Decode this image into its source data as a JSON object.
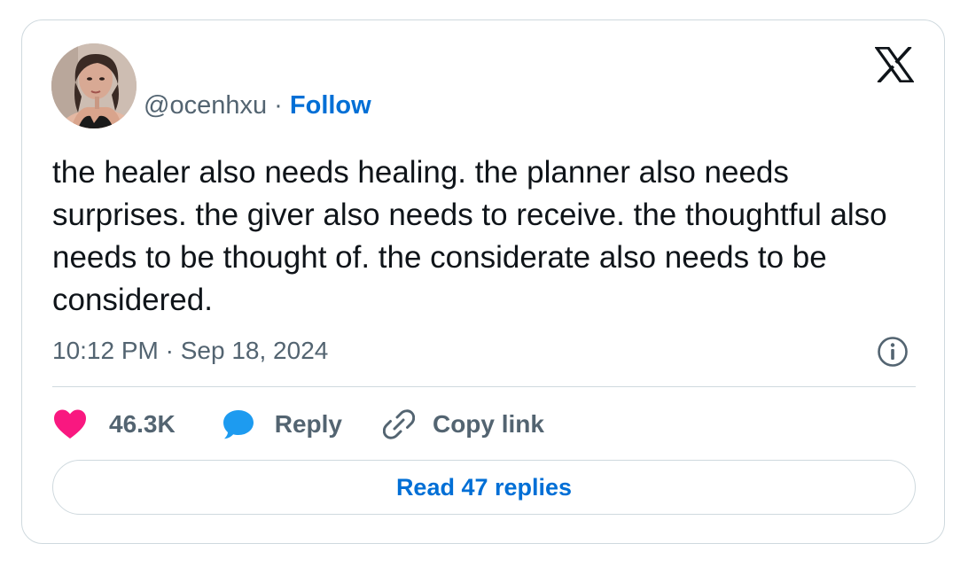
{
  "author": {
    "handle": "@ocenhxu",
    "separator": "·",
    "follow_label": "Follow"
  },
  "brand": {
    "logo_icon": "x-logo-icon"
  },
  "tweet": {
    "text": "the healer also needs healing. the planner also needs surprises. the giver also needs to receive. the thoughtful also needs to be thought of. the considerate also needs to be considered.",
    "time": "10:12 PM",
    "separator": "·",
    "date": "Sep 18, 2024",
    "info_icon": "info-icon"
  },
  "actions": {
    "likes": {
      "icon": "heart-icon",
      "count": "46.3K",
      "color": "#f91880"
    },
    "reply": {
      "icon": "speech-bubble-icon",
      "label": "Reply",
      "color": "#1d9bf0"
    },
    "copy": {
      "icon": "link-icon",
      "label": "Copy link"
    }
  },
  "read_replies": {
    "label": "Read 47 replies"
  },
  "colors": {
    "link_blue": "#006fd6",
    "secondary_text": "#536471",
    "border": "#cfd9de",
    "text": "#0f1419"
  }
}
